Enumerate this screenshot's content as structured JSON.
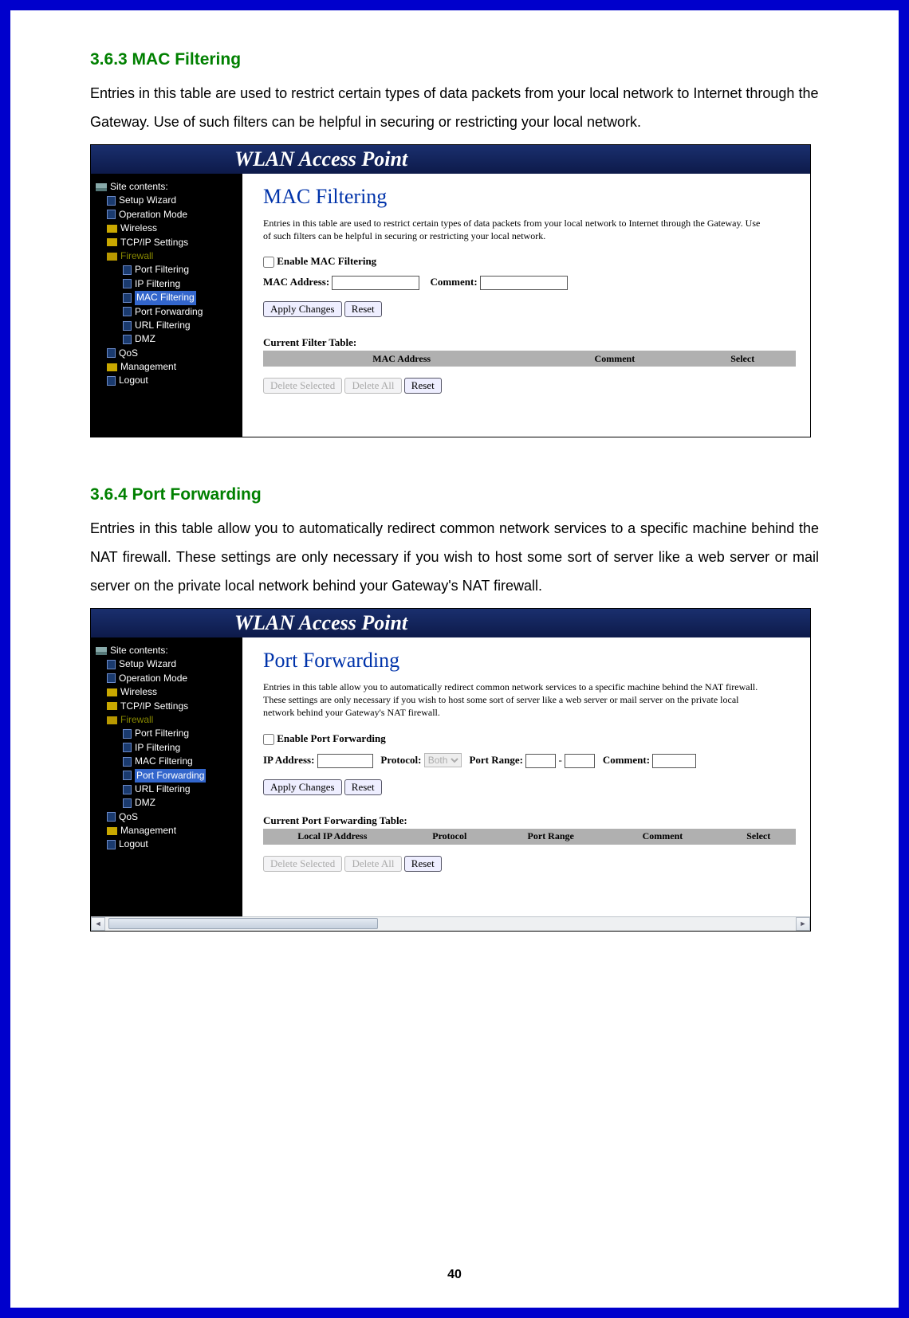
{
  "page_number": "40",
  "sections": {
    "s1": {
      "heading": "3.6.3   MAC Filtering",
      "body": "Entries in this table are used to restrict certain types of data packets from your local network to Internet through the Gateway. Use of such filters can be helpful in securing or restricting your local network."
    },
    "s2": {
      "heading": "3.6.4   Port Forwarding",
      "body": "Entries in this table allow you to automatically redirect common network services to a specific machine behind the NAT firewall. These settings are only necessary if you wish to host some sort of server like a web server or mail server on the private local network behind your Gateway's NAT firewall."
    }
  },
  "app_title": "WLAN Access Point",
  "sidebar": {
    "root": "Site contents:",
    "items": {
      "setup": "Setup Wizard",
      "opmode": "Operation Mode",
      "wireless": "Wireless",
      "tcpip": "TCP/IP Settings",
      "firewall": "Firewall",
      "firewall_children": {
        "portfilter": "Port Filtering",
        "ipfilter": "IP Filtering",
        "macfilter": "MAC Filtering",
        "portfwd": "Port Forwarding",
        "urlfilter": "URL Filtering",
        "dmz": "DMZ"
      },
      "qos": "QoS",
      "mgmt": "Management",
      "logout": "Logout"
    }
  },
  "screenshot1": {
    "title": "MAC Filtering",
    "desc": "Entries in this table are used to restrict certain types of data packets from your local network to Internet through the Gateway. Use of such filters can be helpful in securing or restricting your local network.",
    "enable_label": "Enable MAC Filtering",
    "mac_label": "MAC Address:",
    "comment_label": "Comment:",
    "apply": "Apply Changes",
    "reset": "Reset",
    "table_title": "Current Filter Table:",
    "cols": {
      "c1": "MAC Address",
      "c2": "Comment",
      "c3": "Select"
    },
    "del_sel": "Delete Selected",
    "del_all": "Delete All",
    "reset2": "Reset"
  },
  "screenshot2": {
    "title": "Port Forwarding",
    "desc": "Entries in this table allow you to automatically redirect common network services to a specific machine behind the NAT firewall. These settings are only necessary if you wish to host some sort of server like a web server or mail server on the private local network behind your Gateway's NAT firewall.",
    "enable_label": "Enable Port Forwarding",
    "ip_label": "IP Address:",
    "protocol_label": "Protocol:",
    "protocol_value": "Both",
    "range_label": "Port Range:",
    "range_dash": "-",
    "comment_label": "Comment:",
    "apply": "Apply Changes",
    "reset": "Reset",
    "table_title": "Current Port Forwarding Table:",
    "cols": {
      "c1": "Local IP Address",
      "c2": "Protocol",
      "c3": "Port Range",
      "c4": "Comment",
      "c5": "Select"
    },
    "del_sel": "Delete Selected",
    "del_all": "Delete All",
    "reset2": "Reset"
  }
}
